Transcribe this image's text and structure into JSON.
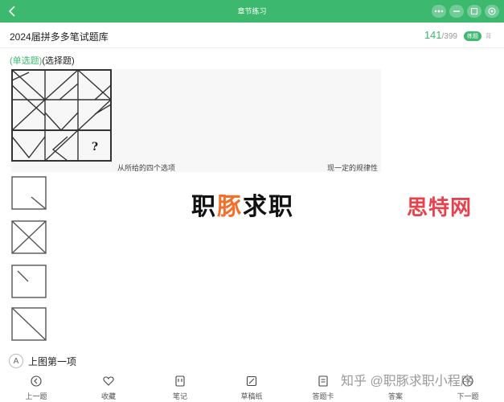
{
  "topbar": {
    "title": "章节练习",
    "back_icon": "chevron-left-icon",
    "window_controls": [
      "more-icon",
      "minimize-icon",
      "restore-icon",
      "close-icon"
    ],
    "color": "#3cb96f"
  },
  "header": {
    "bank_name": "2024届拼多多笔试题库",
    "current": "141",
    "total": "/399",
    "mode_active": "练题",
    "mode_alt": "背"
  },
  "question": {
    "type_label": "(单选题)",
    "type_suffix": "(选择题)",
    "caption_left": "从所给的四个选项",
    "caption_right": "现一定的规律性",
    "unknown_mark": "?"
  },
  "options": [
    {
      "letter": "A",
      "text": "上图第一项",
      "figure": "partial-diagonal"
    },
    {
      "figure": "x-cross"
    },
    {
      "figure": "short-diagonal"
    },
    {
      "figure": "full-diagonal"
    }
  ],
  "watermarks": {
    "center_prefix": "职",
    "center_highlight": "豚",
    "center_suffix": "求职",
    "right": "思特网",
    "bottom": "知乎 @职豚求职小程序"
  },
  "bottom_nav": [
    {
      "label": "上一题",
      "icon": "arrow-left-circle-icon"
    },
    {
      "label": "收藏",
      "icon": "heart-icon"
    },
    {
      "label": "笔记",
      "icon": "note-icon"
    },
    {
      "label": "草稿纸",
      "icon": "draft-paper-icon"
    },
    {
      "label": "答题卡",
      "icon": "answer-card-icon"
    },
    {
      "label": "答案",
      "icon": "answer-icon"
    },
    {
      "label": "下一题",
      "icon": "arrow-right-circle-icon"
    }
  ]
}
